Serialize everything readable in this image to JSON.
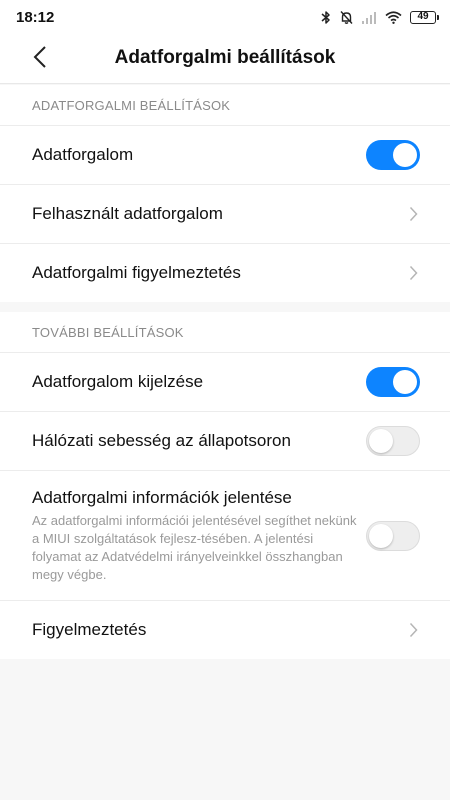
{
  "status_bar": {
    "time": "18:12",
    "battery": "49",
    "icons": [
      "bluetooth-icon",
      "bell-off-icon",
      "signal-icon",
      "wifi-icon",
      "battery-icon"
    ]
  },
  "header": {
    "title": "Adatforgalmi beállítások",
    "back_icon": "chevron-left-icon"
  },
  "section1": {
    "title": "ADATFORGALMI BEÁLLÍTÁSOK",
    "rows": [
      {
        "label": "Adatforgalom",
        "toggle": true
      },
      {
        "label": "Felhasznált adatforgalom",
        "chevron": true
      },
      {
        "label": "Adatforgalmi figyelmeztetés",
        "chevron": true
      }
    ]
  },
  "section2": {
    "title": "TOVÁBBI BEÁLLÍTÁSOK",
    "rows": [
      {
        "label": "Adatforgalom kijelzése",
        "toggle": true
      },
      {
        "label": "Hálózati sebesség az állapotsoron",
        "toggle": false
      },
      {
        "label": "Adatforgalmi információk jelentése",
        "description": "Az adatforgalmi információi jelentésével segíthet nekünk a MIUI szolgáltatások fejlesz-tésében. A jelentési folyamat az Adatvédelmi irányelveinkkel összhangban megy végbe.",
        "toggle": false
      },
      {
        "label": "Figyelmeztetés",
        "chevron": true
      }
    ]
  },
  "colors": {
    "accent": "#0d84ff",
    "background": "#f7f7f7",
    "secondary_text": "#8a8a8a"
  }
}
